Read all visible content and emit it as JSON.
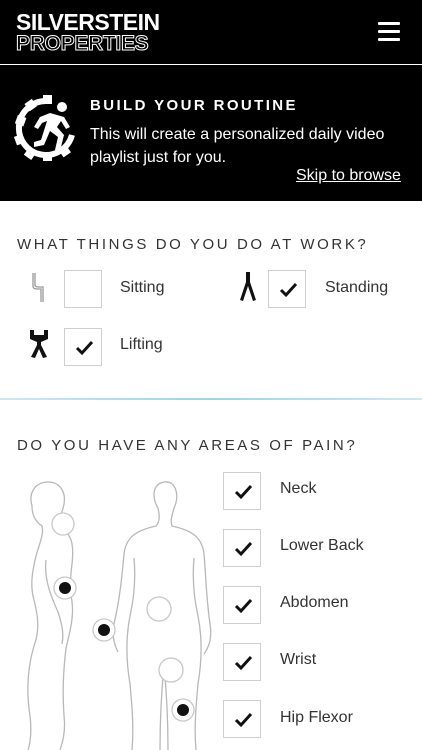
{
  "header": {
    "logo_line1": "SILVERSTEIN",
    "logo_line2": "PROPERTIES",
    "menu_icon": "hamburger-menu-icon"
  },
  "banner": {
    "icon": "gear-runner-icon",
    "title": "BUILD YOUR ROUTINE",
    "description": "This will create a personalized daily video playlist just for you.",
    "skip_label": "Skip to browse"
  },
  "work": {
    "title": "WHAT THINGS DO YOU DO AT WORK?",
    "options": [
      {
        "label": "Sitting",
        "icon": "sitting-icon",
        "checked": false
      },
      {
        "label": "Standing",
        "icon": "standing-icon",
        "checked": true
      },
      {
        "label": "Lifting",
        "icon": "lifting-icon",
        "checked": true
      }
    ]
  },
  "pain": {
    "title": "DO YOU HAVE ANY AREAS OF PAIN?",
    "options": [
      {
        "label": "Neck",
        "checked": true
      },
      {
        "label": "Lower Back",
        "checked": true
      },
      {
        "label": "Abdomen",
        "checked": true
      },
      {
        "label": "Wrist",
        "checked": true
      },
      {
        "label": "Hip Flexor",
        "checked": true
      }
    ]
  },
  "colors": {
    "header_bg": "#000000",
    "accent_line": "#9fd3e4",
    "checkbox_border": "#cfcfcf"
  }
}
